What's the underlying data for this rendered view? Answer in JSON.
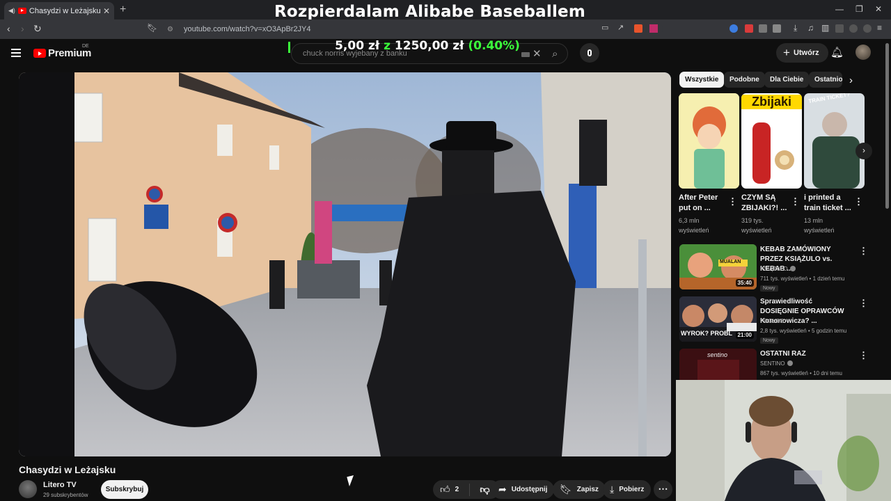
{
  "browser": {
    "tab_title": "Chasydzi w Leżajsku - YouTube",
    "url": "youtube.com/watch?v=xO3ApBr2JY4",
    "new_tab_symbol": "+"
  },
  "stream_overlay": {
    "title": "Rozpierdalam Alibabe Baseballem",
    "donation_current": "5,00 zł",
    "donation_word": "z",
    "donation_goal": "1250,00 zł",
    "donation_percent": "(0.40%)",
    "donation_fraction": 0.004
  },
  "header": {
    "logo_text": "Premium",
    "region": "DE",
    "search_value": "chuck norris wyjebany z banku",
    "create_label": "Utwórz"
  },
  "video": {
    "title": "Chasydzi w Leżajsku",
    "channel_name": "Litero TV",
    "subscribers": "29 subskrybentów",
    "subscribe_label": "Subskrybuj",
    "likes": "2",
    "share_label": "Udostępnij",
    "save_label": "Zapisz",
    "download_label": "Pobierz"
  },
  "sidebar": {
    "chips": [
      "Wszystkie",
      "Podobne",
      "Dla Ciebie",
      "Ostatnio"
    ],
    "shorts": [
      {
        "title": "After Peter put on ...",
        "views": "6,3 mln wyświetleń",
        "thumb_text": ""
      },
      {
        "title": "CZYM SĄ ZBIJAKI?! ...",
        "views": "319 tys. wyświetleń",
        "thumb_text": "Zbijaki"
      },
      {
        "title": "i printed a train ticket ...",
        "views": "13 mln wyświetleń",
        "thumb_text": "TRAIN TICKET?"
      }
    ],
    "recommendations": [
      {
        "title": "KEBAB ZAMÓWIONY PRZEZ KSIĄŻULO vs. KEBAB ...",
        "channel": "KSIĄŻULO",
        "meta": "711 tys. wyświetleń • 1 dzień temu",
        "duration": "35:40",
        "badge": "Nowy",
        "thumb_text": "MUALAN"
      },
      {
        "title": "Sprawiedliwość DOSIĘGNIE OPRAWCÓW Kononowicza? ...",
        "channel": "POGŁOS",
        "meta": "2,8 tys. wyświetleń • 5 godzin temu",
        "duration": "21:00",
        "badge": "Nowy",
        "thumb_text": "WYROK? PROBL"
      },
      {
        "title": "OSTATNI RAZ",
        "channel": "SENTINO",
        "meta": "867 tys. wyświetleń • 10 dni temu",
        "duration": "",
        "badge": "",
        "thumb_text": "sentino"
      }
    ]
  },
  "colors": {
    "background": "#0f0f0f",
    "accent_red": "#ff0000",
    "donation_green": "#3bff3b",
    "chip_bg": "#272727"
  }
}
